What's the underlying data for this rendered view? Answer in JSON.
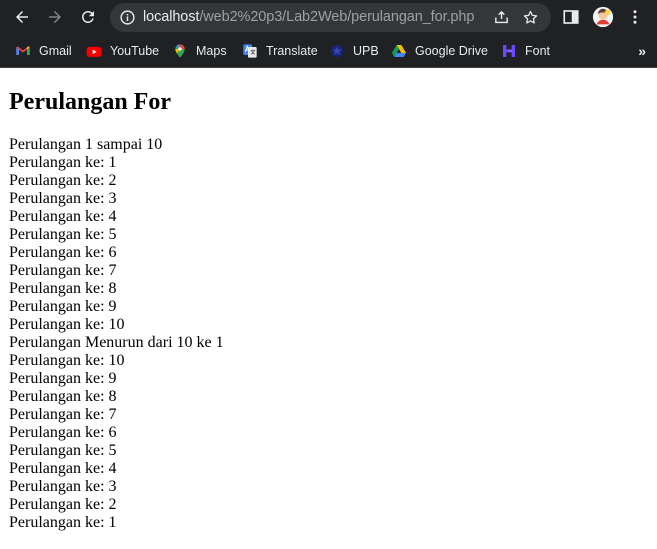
{
  "browser": {
    "url_host": "localhost",
    "url_path": "/web2%20p3/Lab2Web/perulangan_for.php",
    "bookmarks": [
      {
        "label": "Gmail",
        "icon": "gmail-icon"
      },
      {
        "label": "YouTube",
        "icon": "youtube-icon"
      },
      {
        "label": "Maps",
        "icon": "maps-icon"
      },
      {
        "label": "Translate",
        "icon": "translate-icon"
      },
      {
        "label": "UPB",
        "icon": "upb-icon"
      },
      {
        "label": "Google Drive",
        "icon": "google-drive-icon"
      },
      {
        "label": "Font",
        "icon": "font-icon"
      }
    ],
    "more_bookmarks": "»"
  },
  "page": {
    "title": "Perulangan For",
    "lines": [
      "Perulangan 1 sampai 10",
      "Perulangan ke: 1",
      "Perulangan ke: 2",
      "Perulangan ke: 3",
      "Perulangan ke: 4",
      "Perulangan ke: 5",
      "Perulangan ke: 6",
      "Perulangan ke: 7",
      "Perulangan ke: 8",
      "Perulangan ke: 9",
      "Perulangan ke: 10",
      "Perulangan Menurun dari 10 ke 1",
      "Perulangan ke: 10",
      "Perulangan ke: 9",
      "Perulangan ke: 8",
      "Perulangan ke: 7",
      "Perulangan ke: 6",
      "Perulangan ke: 5",
      "Perulangan ke: 4",
      "Perulangan ke: 3",
      "Perulangan ke: 2",
      "Perulangan ke: 1"
    ]
  }
}
